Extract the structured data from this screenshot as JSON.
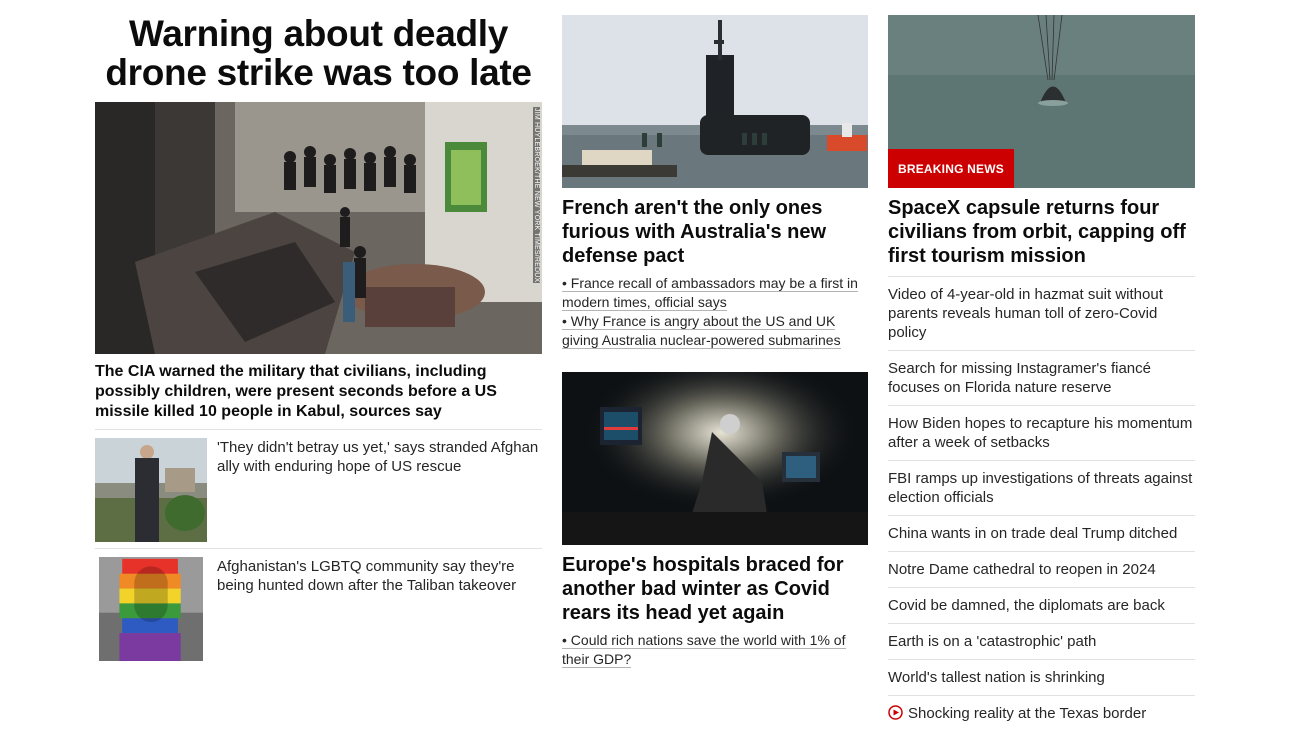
{
  "left": {
    "headline": "Warning about deadly drone strike was too late",
    "hero_credit": "JIM HUYLEBROEK/THE NEW YORK TIMES/REDUX",
    "hero_caption": "The CIA warned the military that civilians, including possibly children, were present seconds before a US missile killed 10 people in Kabul, sources say",
    "stories": [
      {
        "text": "'They didn't betray us yet,' says stranded Afghan ally with enduring hope of US rescue"
      },
      {
        "text": "Afghanistan's LGBTQ community say they're being hunted down after the Taliban takeover"
      }
    ]
  },
  "middle": {
    "card1": {
      "headline": "French aren't the only ones furious with Australia's new defense pact",
      "related": [
        "• France recall of ambassadors may be a first in modern times, official says",
        "• Why France is angry about the US and UK giving Australia nuclear-powered submarines"
      ]
    },
    "card2": {
      "headline": "Europe's hospitals braced for another bad winter as Covid rears its head yet again",
      "related": [
        "• Could rich nations save the world with 1% of their GDP?"
      ]
    }
  },
  "right": {
    "badge": "BREAKING NEWS",
    "headline": "SpaceX capsule returns four civilians from orbit, capping off first tourism mission",
    "items": [
      "Video of 4-year-old in hazmat suit without parents reveals human toll of zero-Covid policy",
      "Search for missing Instagramer's fiancé focuses on Florida nature reserve",
      "How Biden hopes to recapture his momentum after a week of setbacks",
      "FBI ramps up investigations of threats against election officials",
      "China wants in on trade deal Trump ditched",
      "Notre Dame cathedral to reopen in 2024",
      "Covid be damned, the diplomats are back",
      "Earth is on a 'catastrophic' path",
      "World's tallest nation is shrinking",
      "Shocking reality at the Texas border"
    ]
  },
  "colors": {
    "breaking": "#cc0000",
    "divider": "#e1e1e1",
    "text": "#262626"
  }
}
